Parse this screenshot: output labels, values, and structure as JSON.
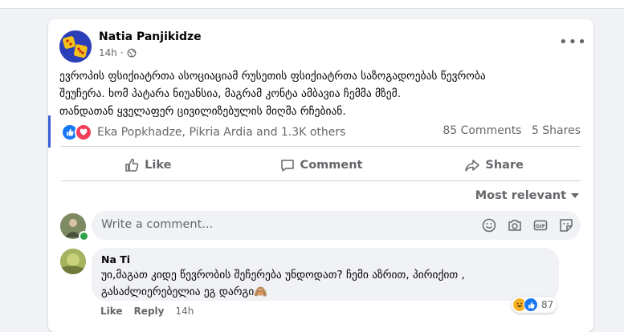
{
  "post": {
    "author": "Natia Panjikidze",
    "time": "14h",
    "separator": "·",
    "more_label": "•••",
    "text_lines": [
      "ევროპის ფსიქიატრთა ასოციაციამ რუსეთის ფსიქიატრთა საზოგადოებას წევრობა",
      "შეუჩერა. ხომ პატარა ნიუანსია, მაგრამ კონტა ამბავია ჩემმა მზემ.",
      "თანდათან ყველაფერ ცივილიზებულის მიღმა რჩებიან."
    ],
    "reactors": "Eka Popkhadze, Pikria Ardia and 1.3K others",
    "comments_count": "85 Comments",
    "shares_count": "5 Shares"
  },
  "actions": {
    "like": "Like",
    "comment": "Comment",
    "share": "Share"
  },
  "sort": {
    "label": "Most relevant"
  },
  "composer": {
    "placeholder": "Write a comment..."
  },
  "comment": {
    "author": "Na Ti",
    "text_lines": [
      "უი,მაგათ კიდე წევრობის შეჩერება უნდოდათ? ჩემი აზრით, პირიქით ,",
      "გასაძლიერებელია ეგ დარგი🙈"
    ],
    "reaction_count": "87",
    "like_label": "Like",
    "reply_label": "Reply",
    "time": "14h"
  },
  "colors": {
    "accent": "#1877f2",
    "love": "#f33e58",
    "secondary_text": "#65676b",
    "background": "#f0f2f5"
  },
  "icons": [
    "globe-icon",
    "like-thumb-icon",
    "comment-bubble-icon",
    "share-arrow-icon",
    "emoji-icon",
    "camera-icon",
    "gif-icon",
    "sticker-icon",
    "chevron-down-icon"
  ]
}
